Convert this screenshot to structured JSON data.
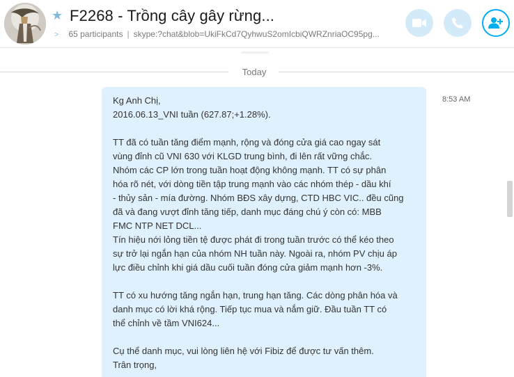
{
  "header": {
    "title": "F2268 - Trồng cây gây rừng...",
    "participants": "65 participants",
    "separator": "|",
    "link": "skype:?chat&blob=UkiFkCd7QyhwuS2omIcbiQWRZnriaOC95pg...",
    "favorite_icon": "star-icon",
    "buttons": {
      "video_icon": "video-camera-icon",
      "call_icon": "phone-icon",
      "add_icon": "add-person-icon"
    },
    "accent_color": "#00aff0"
  },
  "conversation": {
    "day_label": "Today",
    "message": {
      "time": "8:53 AM",
      "bubble_color": "#dff1fc",
      "lines": [
        "Kg Anh Chị,",
        "2016.06.13_VNI tuần (627.87;+1.28%).",
        "",
        "TT đã có tuần tăng điểm mạnh, rộng và đóng cửa giá cao ngay sát",
        "vùng đỉnh cũ VNI 630 với KLGD trung bình, đi lên rất vững chắc.",
        "Nhóm các CP lớn trong tuần hoạt động không mạnh. TT có sự phân",
        "hóa rõ nét, với dòng tiền tập trung mạnh vào các nhóm thép - dầu khí",
        "- thủy sản - mía đường. Nhóm BĐS xây dựng, CTD HBC VIC.. đều cũng",
        "đã và đang vượt đỉnh tăng tiếp, danh mục đáng chú ý còn có: MBB",
        "FMC NTP NET DCL...",
        "Tín hiệu nới lỏng tiền tệ được phát đi trong tuần trước có thể kéo theo",
        "sự trở lại ngắn hạn của nhóm NH tuần này. Ngoài ra, nhóm PV chịu áp",
        "lực điều chỉnh khi giá dầu cuối tuần đóng cửa giảm mạnh hơn -3%.",
        "",
        "TT có xu hướng tăng ngắn hạn, trung hạn tăng. Các dòng phân hóa và",
        "danh mục có lời khá rộng. Tiếp tục mua và nắm giữ. Đầu tuần TT có",
        "thể chỉnh về tầm VNI624...",
        "",
        "Cụ thể danh mục, vui lòng liên hệ với Fibiz để được tư vấn thêm.",
        "Trân trọng,"
      ]
    }
  }
}
